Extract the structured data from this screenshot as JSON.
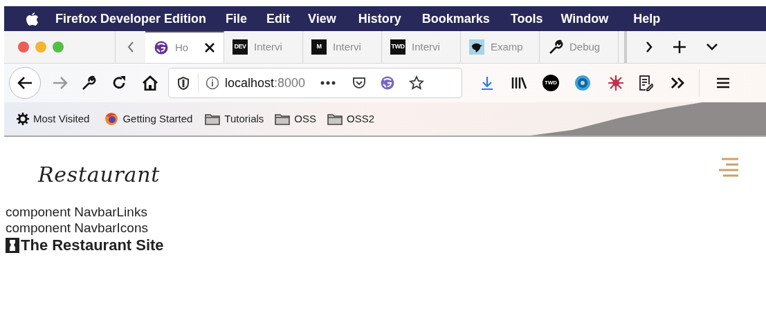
{
  "menubar": {
    "app": "Firefox Developer Edition",
    "items": [
      "File",
      "Edit",
      "View",
      "History",
      "Bookmarks",
      "Tools",
      "Window",
      "Help"
    ]
  },
  "tabs": [
    {
      "label": "Ho",
      "kind": "gatsby",
      "selected": true
    },
    {
      "label": "Intervi",
      "kind": "badge",
      "badge": "DEV",
      "selected": false
    },
    {
      "label": "Intervi",
      "kind": "badge",
      "badge": "M",
      "selected": false
    },
    {
      "label": "Intervi",
      "kind": "badge",
      "badge": "TWD",
      "selected": false
    },
    {
      "label": "Examp",
      "kind": "bird",
      "selected": false
    },
    {
      "label": "Debug",
      "kind": "wrench",
      "selected": false
    }
  ],
  "address_bar": {
    "url_host": "localhost",
    "url_port": ":8000"
  },
  "toolbar": {
    "badge": "TWD"
  },
  "bookmarks": [
    {
      "label": "Most Visited",
      "kind": "gear"
    },
    {
      "label": "Getting Started",
      "kind": "firefox"
    },
    {
      "label": "Tutorials",
      "kind": "folder"
    },
    {
      "label": "OSS",
      "kind": "folder"
    },
    {
      "label": "OSS2",
      "kind": "folder"
    }
  ],
  "page": {
    "logo": "Restaurant",
    "lines": [
      "component NavbarLinks",
      "component NavbarIcons"
    ],
    "heading": "The Restaurant Site"
  }
}
